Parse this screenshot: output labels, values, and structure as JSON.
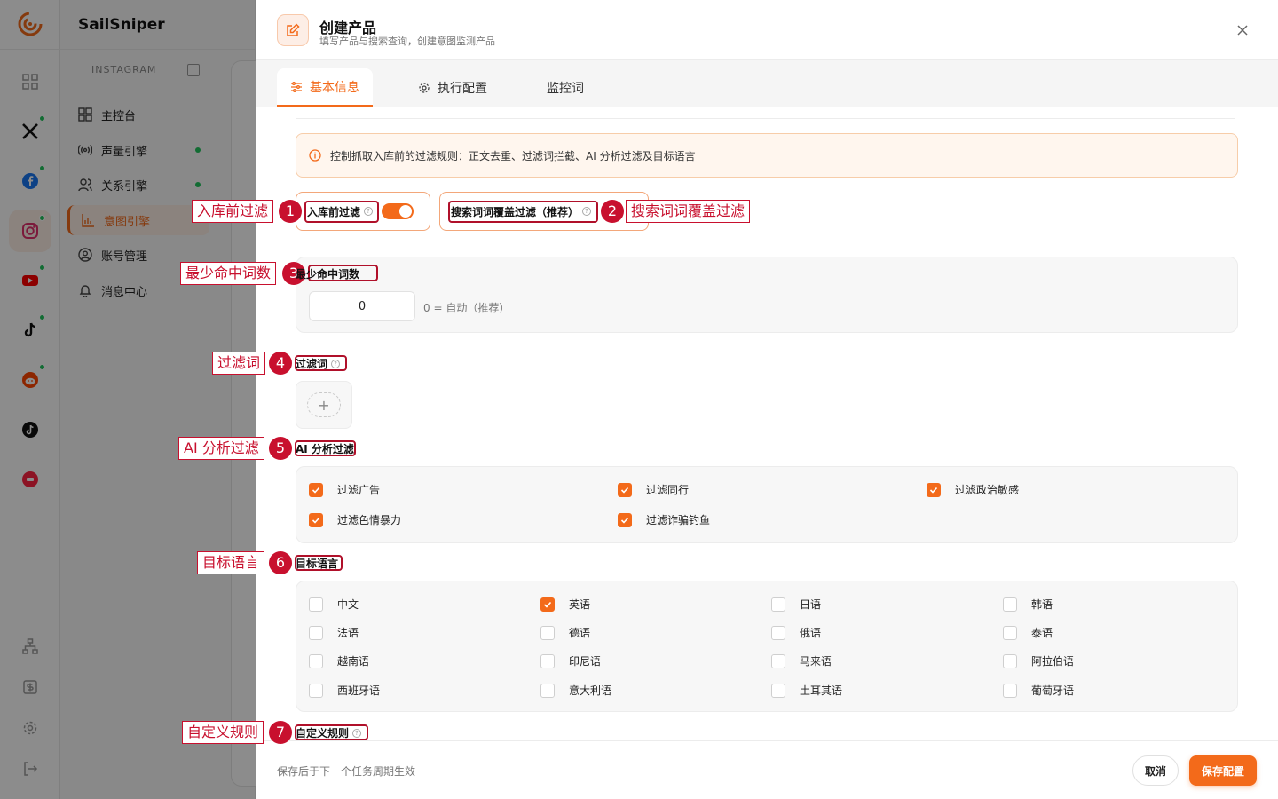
{
  "app": {
    "brand": "SailSniper"
  },
  "sidebar": {
    "section": "INSTAGRAM",
    "items": [
      {
        "label": "主控台"
      },
      {
        "label": "声量引擎"
      },
      {
        "label": "关系引擎"
      },
      {
        "label": "意图引擎"
      },
      {
        "label": "账号管理"
      },
      {
        "label": "消息中心"
      }
    ]
  },
  "rail": {
    "icons": [
      "grid-icon",
      "x-icon",
      "facebook-icon",
      "instagram-icon",
      "youtube-icon",
      "tiktok-icon",
      "reddit-icon",
      "tiktok-alt-icon",
      "xiaohongshu-icon"
    ],
    "bottom_icons": [
      "org-chart-icon",
      "billing-icon",
      "settings-icon",
      "logout-icon"
    ]
  },
  "drawer": {
    "title": "创建产品",
    "subtitle": "填写产品与搜索查询，创建意图监测产品",
    "tabs": [
      {
        "label": "基本信息"
      },
      {
        "label": "执行配置"
      },
      {
        "label": "监控词"
      }
    ],
    "notice": "控制抓取入库前的过滤规则：正文去重、过滤词拦截、AI 分析过滤及目标语言",
    "prefilter": {
      "label": "入库前过滤",
      "enabled": true
    },
    "search_cover": {
      "label": "搜索词词覆盖过滤（推荐）"
    },
    "min_hits": {
      "label": "最少命中词数",
      "value": "0",
      "hint": "0 = 自动（推荐）"
    },
    "filter_words": {
      "label": "过滤词",
      "add": "+"
    },
    "ai_filter": {
      "label": "AI 分析过滤",
      "options": [
        {
          "label": "过滤广告",
          "checked": true
        },
        {
          "label": "过滤同行",
          "checked": true
        },
        {
          "label": "过滤政治敏感",
          "checked": true
        },
        {
          "label": "过滤色情暴力",
          "checked": true
        },
        {
          "label": "过滤诈骗钓鱼",
          "checked": true
        }
      ]
    },
    "languages": {
      "label": "目标语言",
      "options": [
        {
          "label": "中文",
          "checked": false
        },
        {
          "label": "英语",
          "checked": true
        },
        {
          "label": "日语",
          "checked": false
        },
        {
          "label": "韩语",
          "checked": false
        },
        {
          "label": "法语",
          "checked": false
        },
        {
          "label": "德语",
          "checked": false
        },
        {
          "label": "俄语",
          "checked": false
        },
        {
          "label": "泰语",
          "checked": false
        },
        {
          "label": "越南语",
          "checked": false
        },
        {
          "label": "印尼语",
          "checked": false
        },
        {
          "label": "马来语",
          "checked": false
        },
        {
          "label": "阿拉伯语",
          "checked": false
        },
        {
          "label": "西班牙语",
          "checked": false
        },
        {
          "label": "意大利语",
          "checked": false
        },
        {
          "label": "土耳其语",
          "checked": false
        },
        {
          "label": "葡萄牙语",
          "checked": false
        }
      ]
    },
    "custom_rules": {
      "label": "自定义规则"
    },
    "footer": {
      "hint": "保存后于下一个任务周期生效",
      "cancel": "取消",
      "save": "保存配置"
    }
  },
  "annotations": [
    {
      "num": "1",
      "label": "入库前过滤"
    },
    {
      "num": "2",
      "label": "搜索词词覆盖过滤"
    },
    {
      "num": "3",
      "label": "最少命中词数"
    },
    {
      "num": "4",
      "label": "过滤词"
    },
    {
      "num": "5",
      "label": "AI 分析过滤"
    },
    {
      "num": "6",
      "label": "目标语言"
    },
    {
      "num": "7",
      "label": "自定义规则"
    }
  ],
  "colors": {
    "accent": "#f36a1a",
    "annotation": "#c8102e",
    "success": "#22c55e"
  }
}
